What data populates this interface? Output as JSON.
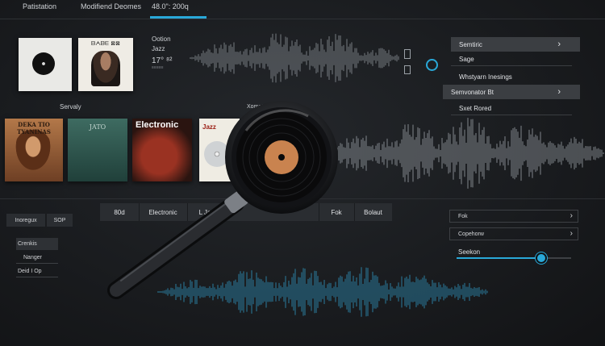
{
  "tabs": [
    "Patistation",
    "Modifiend Deomes",
    "48.0\": 200q"
  ],
  "album_strip": {
    "album2_title": "ᗷᗅᗷᗴ ⊠⊠"
  },
  "track": {
    "line1": "Ootion",
    "line2": "Jazz",
    "line3": "17°  ⁸²",
    "line4": "≡≡≡≡≡"
  },
  "right_menu": [
    {
      "label": "Semtiric",
      "chevron": "›"
    },
    {
      "label": "Sage"
    },
    {
      "label": "Whstyarn Inesings"
    },
    {
      "label": "Semvonator Bt",
      "chevron": "›"
    },
    {
      "label": "Sxet Rored"
    }
  ],
  "section_label": "Servaly",
  "covers": [
    {
      "title": "DEKA TIO TYANINAS"
    },
    {
      "title": "JATO"
    },
    {
      "title": "Electronic"
    },
    {
      "title": "Jazz"
    }
  ],
  "cover_caption": "Xomate  ᕦᑕᔑᐤ",
  "filters": [
    "80d",
    "Electronic",
    "L Jaz",
    "Fok",
    "Bolaut"
  ],
  "left_controls": {
    "buttons": [
      "Inoregux",
      "SOP"
    ],
    "list": [
      "Crenkis",
      "Nanger",
      "Deid I Op"
    ]
  },
  "right_boxes": [
    {
      "label": "Fok",
      "chevron": "›"
    },
    {
      "label": "Copehorw",
      "chevron": "›"
    }
  ],
  "slider": {
    "label": "Seekon",
    "value": 0.74
  },
  "colors": {
    "accent": "#29a8d8",
    "background": "#1c1e21"
  },
  "icons": [
    "vinyl-record-icon",
    "magnifying-glass-icon",
    "chevron-right-icon",
    "waveform-icon"
  ]
}
